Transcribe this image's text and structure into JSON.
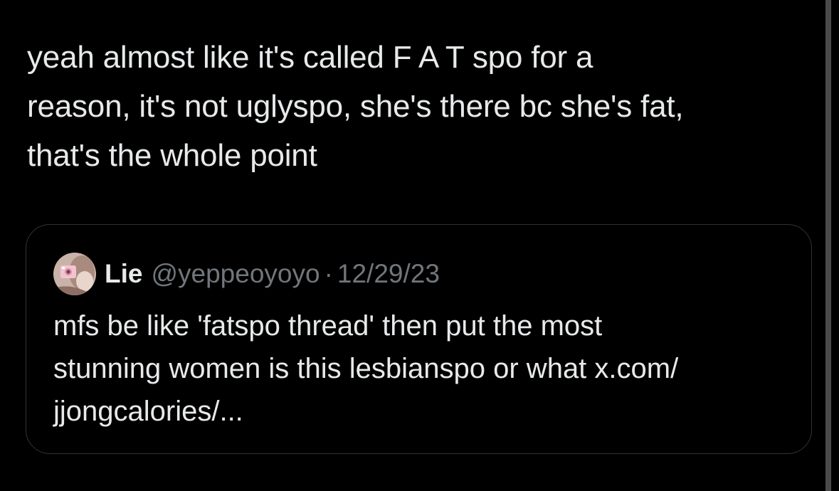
{
  "tweet": {
    "text": "yeah almost like it's called F A T spo for a\nreason, it's not uglyspo, she's there bc she's fat,\nthat's the whole point"
  },
  "quoted_tweet": {
    "author_name": "Lie",
    "handle": "@yeppeoyoyo",
    "separator": "·",
    "date": "12/29/23",
    "text": "mfs be like 'fatspo thread' then put the most\nstunning women is this lesbianspo or what x.com/\njjongcalories/...",
    "avatar_icon": "profile-photo"
  },
  "colors": {
    "background": "#000000",
    "text_primary": "#e7e9ea",
    "text_secondary": "#71767b",
    "card_border": "#2f3336"
  }
}
